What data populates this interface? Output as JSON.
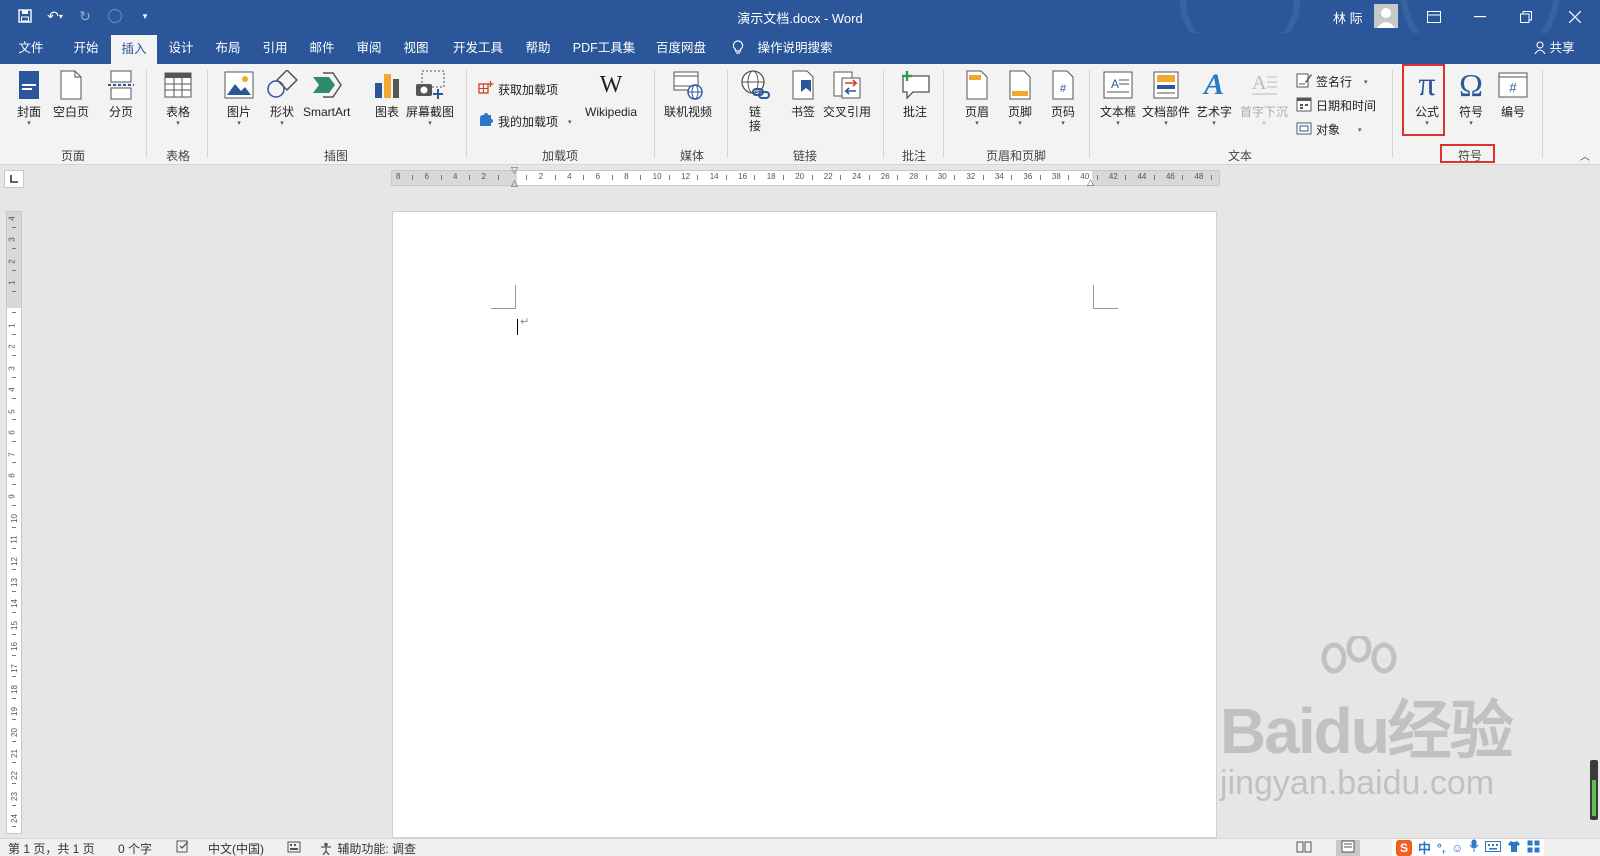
{
  "titlebar": {
    "title": "演示文档.docx - Word",
    "user": "林 际"
  },
  "menu": {
    "tabs": [
      "文件",
      "开始",
      "插入",
      "设计",
      "布局",
      "引用",
      "邮件",
      "审阅",
      "视图",
      "开发工具",
      "帮助",
      "PDF工具集",
      "百度网盘"
    ],
    "active": "插入",
    "search": "操作说明搜索",
    "share": "共享"
  },
  "ribbon": {
    "groups": {
      "page": "页面",
      "table": "表格",
      "illustrations": "插图",
      "addins": "加载项",
      "media": "媒体",
      "links": "链接",
      "comments": "批注",
      "headerfooter": "页眉和页脚",
      "text": "文本",
      "symbols": "符号"
    },
    "buttons": {
      "cover": "封面",
      "blank": "空白页",
      "pagebreak": "分页",
      "table": "表格",
      "picture": "图片",
      "shapes": "形状",
      "smartart": "SmartArt",
      "chart": "图表",
      "screenshot": "屏幕截图",
      "getaddins": "获取加载项",
      "myaddins": "我的加载项",
      "wikipedia": "Wikipedia",
      "onlinevideo": "联机视频",
      "link1": "链",
      "link2": "接",
      "bookmark": "书签",
      "crossref": "交叉引用",
      "comment": "批注",
      "header": "页眉",
      "footer": "页脚",
      "pagenum": "页码",
      "textbox": "文本框",
      "quickparts": "文档部件",
      "wordart": "艺术字",
      "dropcap": "首字下沉",
      "signature": "签名行",
      "datetime": "日期和时间",
      "object": "对象",
      "equation": "公式",
      "symbol": "符号",
      "number": "编号"
    }
  },
  "ruler": {
    "h": [
      "8",
      "6",
      "4",
      "2",
      "",
      "2",
      "4",
      "6",
      "8",
      "10",
      "12",
      "14",
      "16",
      "18",
      "20",
      "22",
      "24",
      "26",
      "28",
      "30",
      "32",
      "34",
      "36",
      "38",
      "40",
      "42",
      "44",
      "46",
      "48"
    ],
    "v": [
      "4",
      "3",
      "2",
      "1",
      "",
      "1",
      "2",
      "3",
      "4",
      "5",
      "6",
      "7",
      "8",
      "9",
      "10",
      "11",
      "12",
      "13",
      "14",
      "15",
      "16",
      "17",
      "18",
      "19",
      "20",
      "21",
      "22",
      "23",
      "24"
    ]
  },
  "status": {
    "page": "第 1 页，共 1 页",
    "words": "0 个字",
    "lang": "中文(中国)",
    "accessibility": "辅助功能: 调查"
  },
  "ime": {
    "lang": "中",
    "punct": "°,"
  },
  "watermark": {
    "brand": "Baidu经验",
    "url": "jingyan.baidu.com"
  },
  "colors": {
    "accent": "#2b579a",
    "highlight": "#e03030"
  }
}
